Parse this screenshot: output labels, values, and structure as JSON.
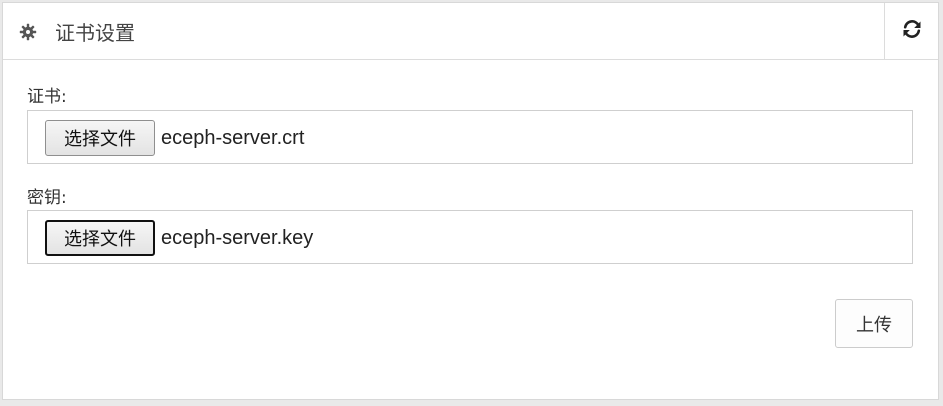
{
  "panel": {
    "title": "证书设置",
    "icons": {
      "title_icon": "gear-icon",
      "refresh_icon": "refresh-icon"
    }
  },
  "certificate": {
    "label": "证书:",
    "button_label": "选择文件",
    "file_name": "eceph-server.crt"
  },
  "key": {
    "label": "密钥:",
    "button_label": "选择文件",
    "file_name": "eceph-server.key"
  },
  "actions": {
    "upload_label": "上传"
  }
}
